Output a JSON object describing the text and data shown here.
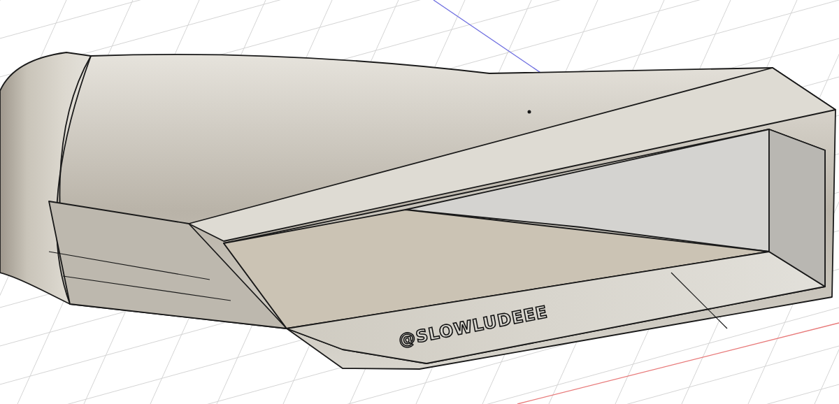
{
  "viewport": {
    "model_text": "@SLOWLUDEEE"
  }
}
